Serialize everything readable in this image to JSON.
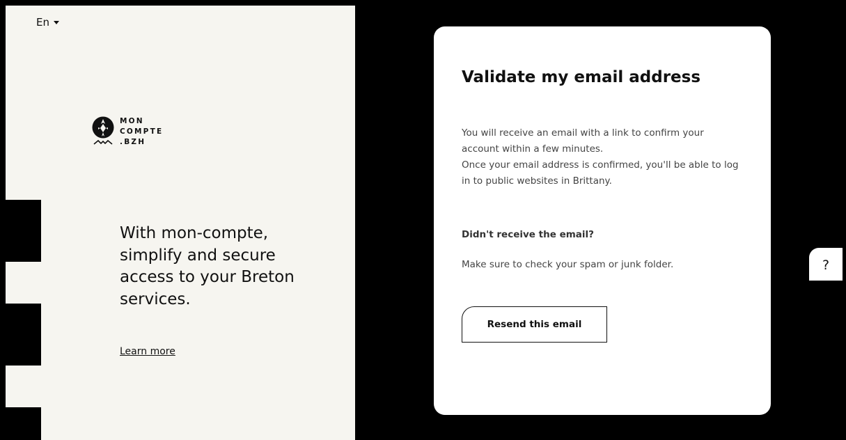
{
  "language": {
    "label": "En"
  },
  "logo": {
    "line1": "MON",
    "line2": "COMPTE",
    "line3": ".BZH"
  },
  "hero": {
    "tagline": "With mon-compte, simplify and secure access to your Breton services.",
    "learn_more": "Learn more"
  },
  "card": {
    "title": "Validate my email address",
    "paragraph1": "You will receive an email with a link to confirm your account within a few minutes.",
    "paragraph2": "Once your email address is confirmed, you'll be able to log in to public websites in Brittany.",
    "question": "Didn't receive the email?",
    "tip": "Make sure to check your spam or junk folder.",
    "resend_button": "Resend this email"
  },
  "help": {
    "label": "?"
  },
  "colors": {
    "panel_bg": "#f6f5f0",
    "page_bg": "#000000",
    "card_bg": "#ffffff",
    "text": "#111111"
  }
}
